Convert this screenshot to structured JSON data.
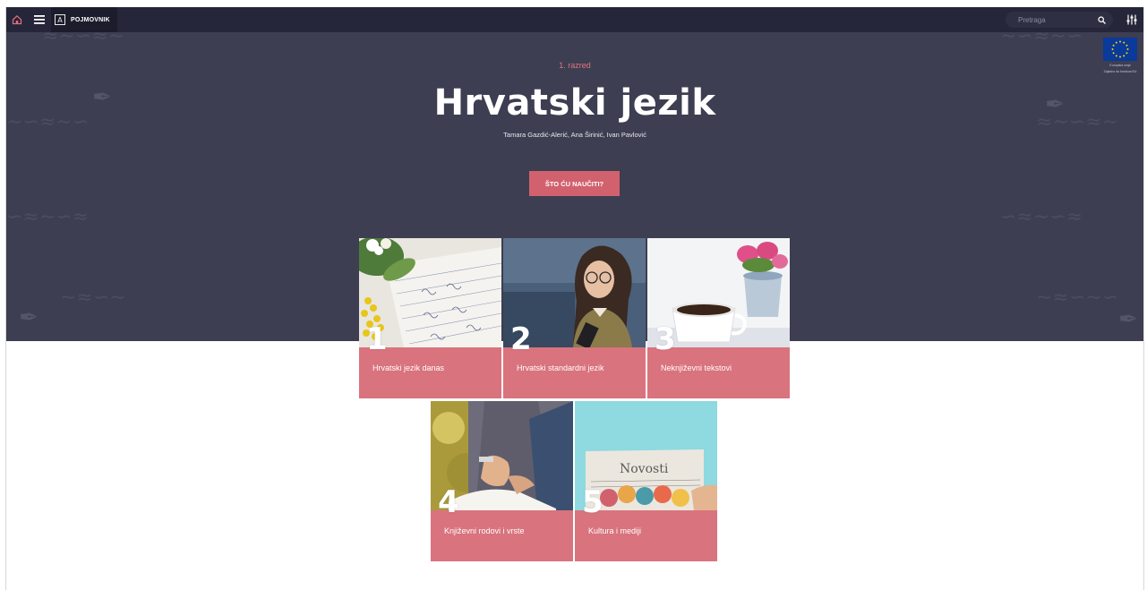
{
  "topbar": {
    "glossary_icon_letter": "A",
    "glossary_label": "POJMOVNIK",
    "search_placeholder": "Pretraga"
  },
  "hero": {
    "grade": "1. razred",
    "title": "Hrvatski jezik",
    "authors": "Tamara Gazdić-Alerić, Ana Širinić, Ivan Pavlović",
    "cta_label": "ŠTO ĆU NAUČITI?",
    "eu_caption_line1": "Europska unija",
    "eu_caption_line2": "Zajedno do fondova EU"
  },
  "units": [
    {
      "number": "1",
      "title": "Hrvatski jezik danas"
    },
    {
      "number": "2",
      "title": "Hrvatski standardni jezik"
    },
    {
      "number": "3",
      "title": "Neknjiževni tekstovi"
    },
    {
      "number": "4",
      "title": "Književni rodovi i vrste"
    },
    {
      "number": "5",
      "title": "Kultura i mediji"
    }
  ],
  "tile5_newspaper_text": "Novosti",
  "colors": {
    "topbar": "#26263a",
    "hero": "#3d3e51",
    "accent": "#d2616e",
    "tile_band": "#d9737d"
  }
}
